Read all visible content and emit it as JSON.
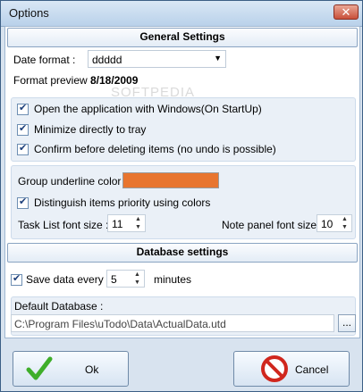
{
  "window": {
    "title": "Options",
    "close_glyph": "✕"
  },
  "general": {
    "header": "General Settings",
    "date_format_label": "Date format :",
    "date_format_value": "ddddd",
    "format_preview_label": "Format preview :",
    "format_preview_value": "8/18/2009",
    "checkboxes": [
      {
        "label": "Open the application with Windows(On StartUp)",
        "checked": true
      },
      {
        "label": "Minimize directly to tray",
        "checked": true
      },
      {
        "label": "Confirm before deleting items (no undo is possible)",
        "checked": true
      }
    ],
    "group_underline_label": "Group underline color :",
    "group_underline_color": "#e8752f",
    "distinguish_label": "Distinguish items priority using colors",
    "distinguish_checked": true,
    "task_font_label": "Task List font size :",
    "task_font_value": "11",
    "note_font_label": "Note panel font size :",
    "note_font_value": "10"
  },
  "database": {
    "header": "Database settings",
    "save_label": "Save data every :",
    "save_checked": true,
    "save_value": "5",
    "save_unit": "minutes",
    "default_db_label": "Default Database :",
    "default_db_path": "C:\\Program Files\\uTodo\\Data\\ActualData.utd",
    "browse_label": "..."
  },
  "buttons": {
    "ok": "Ok",
    "cancel": "Cancel"
  },
  "watermark": "SOFTPEDIA",
  "icons": {
    "ok": "checkmark-icon",
    "cancel": "no-entry-icon",
    "dropdown": "chevron-down-icon"
  }
}
